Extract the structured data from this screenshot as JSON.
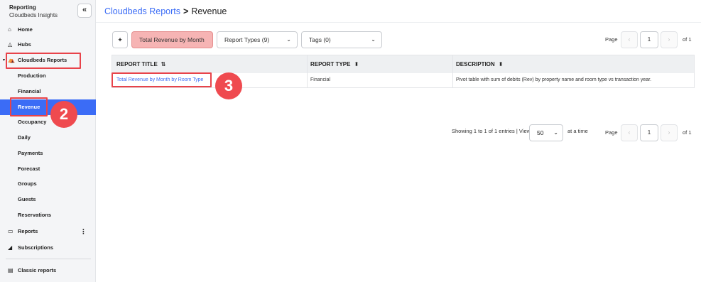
{
  "app": {
    "title": "Reporting",
    "subtitle": "Cloudbeds Insights",
    "collapse_icon": "«"
  },
  "sidebar": {
    "items": [
      {
        "label": "Home",
        "icon": "home-icon"
      },
      {
        "label": "Hubs",
        "icon": "hubs-icon"
      },
      {
        "label": "Cloudbeds Reports",
        "icon": "folder-icon",
        "expanded": true
      },
      {
        "label": "Production"
      },
      {
        "label": "Financial"
      },
      {
        "label": "Revenue",
        "active": true
      },
      {
        "label": "Occupancy"
      },
      {
        "label": "Daily"
      },
      {
        "label": "Payments"
      },
      {
        "label": "Forecast"
      },
      {
        "label": "Groups"
      },
      {
        "label": "Guests"
      },
      {
        "label": "Reservations"
      },
      {
        "label": "Reports",
        "icon": "reports-icon"
      },
      {
        "label": "Subscriptions",
        "icon": "send-icon"
      },
      {
        "label": "Classic reports",
        "icon": "classic-reports-icon"
      }
    ],
    "kebab": "⋮"
  },
  "breadcrumb": {
    "parent": "Cloudbeds Reports",
    "separator": ">",
    "current": "Revenue"
  },
  "toolbar": {
    "search_value": "Total Revenue by Month",
    "report_types_label": "Report Types (9)",
    "tags_label": "Tags (0)"
  },
  "pagination": {
    "page_label": "Page",
    "current_page": "1",
    "of_label": "of 1",
    "prev": "‹",
    "next": "›"
  },
  "table": {
    "headers": [
      "REPORT TITLE",
      "REPORT TYPE",
      "DESCRIPTION"
    ],
    "rows": [
      {
        "title": "Total Revenue by Month by Room Type",
        "type": "Financial",
        "description": "Pivot table with sum of debits (Rev) by property name and room type vs transaction year."
      }
    ]
  },
  "footer": {
    "showing": "Showing 1 to 1 of 1 entries | View",
    "per_page": "50",
    "at_a_time": "at a time"
  },
  "annotations": {
    "step_2": "2",
    "step_3": "3"
  },
  "colors": {
    "accent": "#3b6cf6",
    "highlight": "#e8434a",
    "search_fill": "#f6b4b4"
  }
}
